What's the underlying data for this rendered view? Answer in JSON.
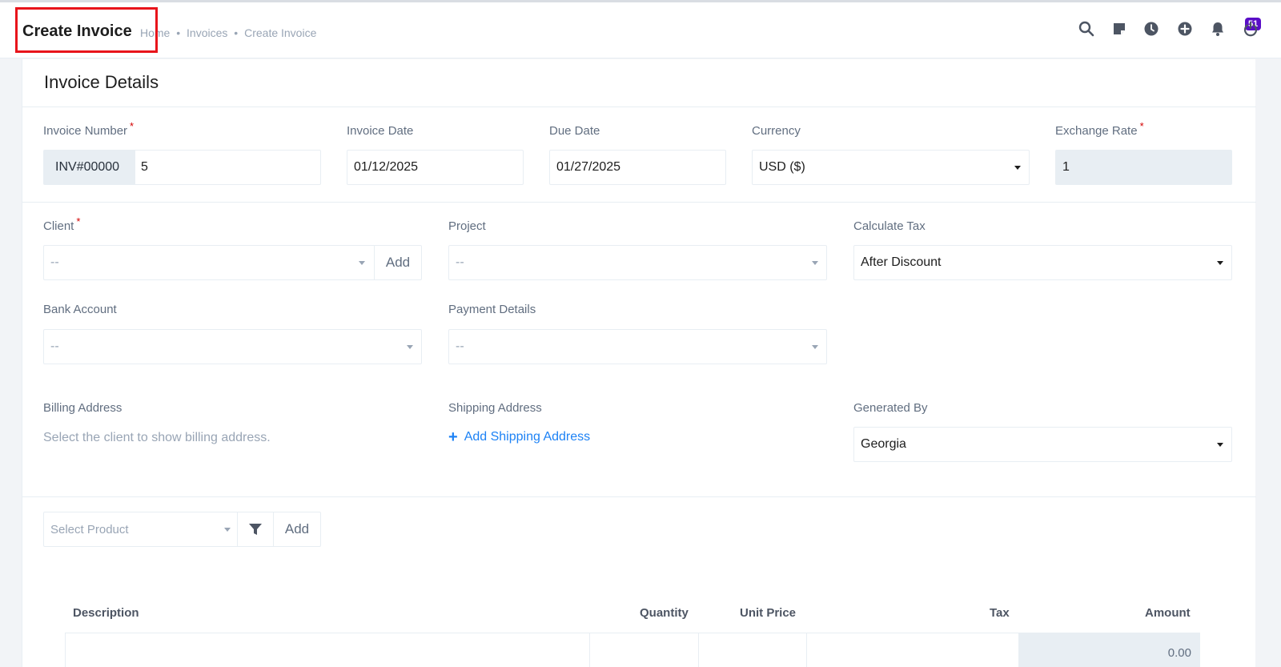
{
  "header": {
    "title": "Create Invoice",
    "breadcrumb": [
      "Home",
      "Invoices",
      "Create Invoice"
    ],
    "breadcrumb_separator": "•",
    "notification_count": "51",
    "icons": [
      "search-icon",
      "sticky-note-icon",
      "clock-icon",
      "plus-circle-icon",
      "bell-icon",
      "power-icon"
    ]
  },
  "card": {
    "title": "Invoice Details"
  },
  "form": {
    "invoice_number": {
      "label": "Invoice Number",
      "required": "*",
      "prefix": "INV#00000",
      "value": "5"
    },
    "invoice_date": {
      "label": "Invoice Date",
      "value": "01/12/2025"
    },
    "due_date": {
      "label": "Due Date",
      "value": "01/27/2025"
    },
    "currency": {
      "label": "Currency",
      "value": "USD ($)"
    },
    "exchange_rate": {
      "label": "Exchange Rate",
      "required": "*",
      "value": "1"
    },
    "client": {
      "label": "Client",
      "required": "*",
      "placeholder": "--",
      "add_label": "Add"
    },
    "project": {
      "label": "Project",
      "placeholder": "--"
    },
    "calculate_tax": {
      "label": "Calculate Tax",
      "value": "After Discount"
    },
    "bank_account": {
      "label": "Bank Account",
      "placeholder": "--"
    },
    "payment_details": {
      "label": "Payment Details",
      "placeholder": "--"
    },
    "billing_address": {
      "label": "Billing Address",
      "hint": "Select the client to show billing address."
    },
    "shipping_address": {
      "label": "Shipping Address",
      "link_label": "Add Shipping Address",
      "link_icon": "+"
    },
    "generated_by": {
      "label": "Generated By",
      "value": "Georgia"
    }
  },
  "product": {
    "placeholder": "Select Product",
    "filter_icon": "filter-icon",
    "add_label": "Add"
  },
  "table": {
    "headers": [
      "Description",
      "Quantity",
      "Unit Price",
      "Tax",
      "Amount"
    ],
    "row": {
      "amount": "0.00"
    }
  },
  "colors": {
    "accent": "#1d82f5",
    "required": "#d30000",
    "badge": "#5a0ec7",
    "highlight": "#e8141b"
  }
}
